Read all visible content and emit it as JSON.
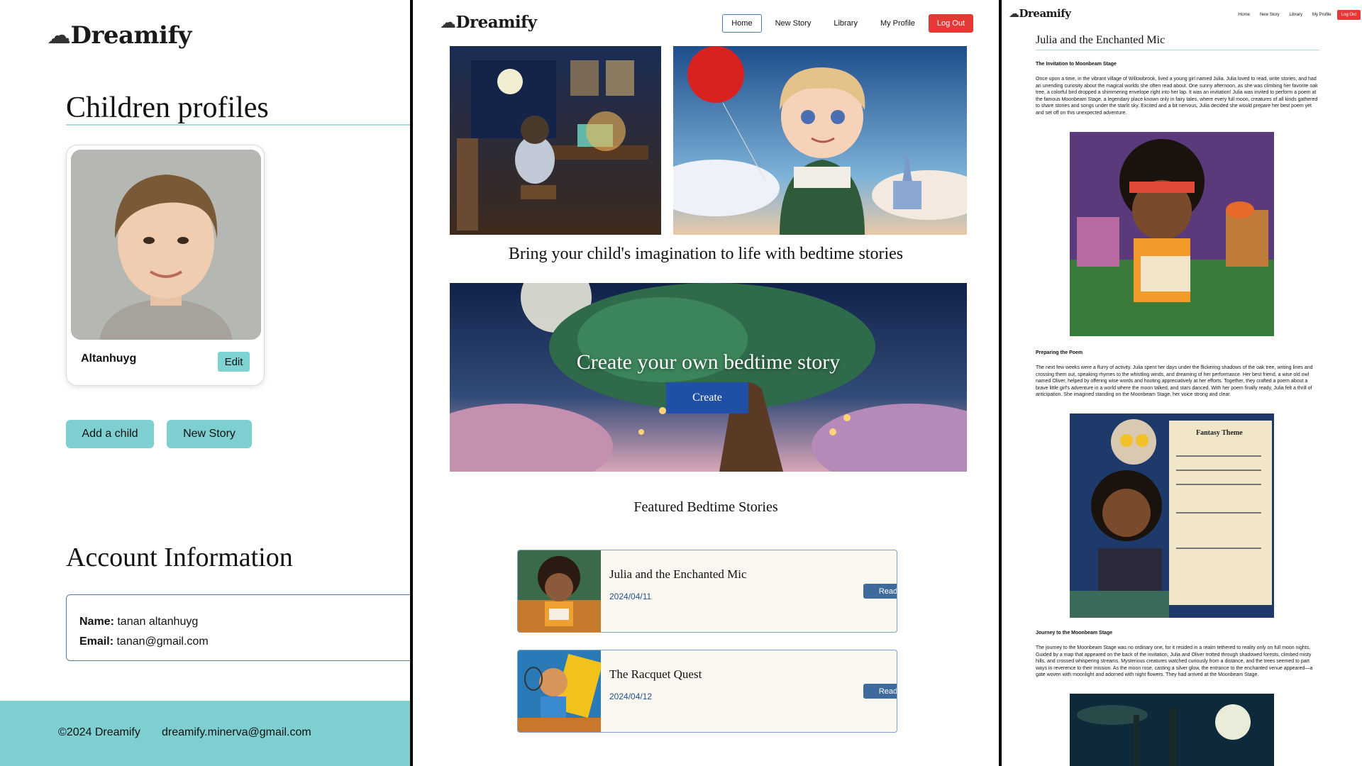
{
  "left": {
    "logo": "Dreamify",
    "children_title": "Children profiles",
    "child": {
      "name": "Altanhuyg",
      "edit_label": "Edit"
    },
    "add_child_label": "Add a child",
    "new_story_label": "New Story",
    "account_title": "Account Information",
    "account": {
      "name_label": "Name:",
      "name_value": "tanan altanhuyg",
      "email_label": "Email:",
      "email_value": "tanan@gmail.com"
    },
    "footer": {
      "copyright": "©2024 Dreamify",
      "email": "dreamify.minerva@gmail.com"
    }
  },
  "mid": {
    "logo": "Dreamify",
    "nav": {
      "home": "Home",
      "new_story": "New Story",
      "library": "Library",
      "profile": "My Profile",
      "logout": "Log Out"
    },
    "tagline": "Bring your child's imagination to life with bedtime stories",
    "banner_text": "Create your own bedtime story",
    "create_label": "Create",
    "featured_title": "Featured Bedtime Stories",
    "stories": [
      {
        "title": "Julia and the Enchanted Mic",
        "date": "2024/04/11",
        "read_label": "Read"
      },
      {
        "title": "The Racquet Quest",
        "date": "2024/04/12",
        "read_label": "Read"
      }
    ]
  },
  "right": {
    "logo": "Dreamify",
    "nav": {
      "home": "Home",
      "new_story": "New Story",
      "library": "Library",
      "profile": "My Profile",
      "logout": "Log Out"
    },
    "story_title": "Julia and the Enchanted Mic",
    "sections": [
      {
        "heading": "The Invitation to Moonbeam Stage",
        "text": "Once upon a time, in the vibrant village of Willowbrook, lived a young girl named Julia. Julia loved to read, write stories, and had an unending curiosity about the magical worlds she often read about. One sunny afternoon, as she was climbing her favorite oak tree, a colorful bird dropped a shimmering envelope right into her lap. It was an invitation! Julia was invited to perform a poem at the famous Moonbeam Stage, a legendary place known only in fairy tales, where every full moon, creatures of all kinds gathered to share stories and songs under the starlit sky. Excited and a bit nervous, Julia decided she would prepare her best poem yet and set off on this unexpected adventure."
      },
      {
        "heading": "Preparing the Poem",
        "text": "The next few weeks were a flurry of activity. Julia spent her days under the flickering shadows of the oak tree, writing lines and crossing them out, speaking rhymes to the whistling winds, and dreaming of her performance. Her best friend, a wise old owl named Oliver, helped by offering wise words and hooting appreciatively at her efforts. Together, they crafted a poem about a brave little girl's adventure in a world where the moon talked, and stars danced. With her poem finally ready, Julia felt a thrill of anticipation. She imagined standing on the Moonbeam Stage, her voice strong and clear."
      },
      {
        "heading": "Journey to the Moonbeam Stage",
        "text": "The journey to the Moonbeam Stage was no ordinary one, for it resided in a realm tethered to reality only on full moon nights. Guided by a map that appeared on the back of the invitation, Julia and Oliver trotted through shadowed forests, climbed misty hills, and crossed whispering streams. Mysterious creatures watched curiously from a distance, and the trees seemed to part ways in reverence to their mission. As the moon rose, casting a silver glow, the entrance to the enchanted venue appeared—a gate woven with moonlight and adorned with night flowers. They had arrived at the Moonbeam Stage."
      }
    ],
    "fantasy_label": "Fantasy Theme"
  },
  "colors": {
    "teal": "#7dcfd0",
    "logout_red": "#e53935",
    "create_blue": "#1f4fa6",
    "read_blue": "#3f6a9e"
  },
  "icons": [
    "cloud-logo-icon"
  ]
}
